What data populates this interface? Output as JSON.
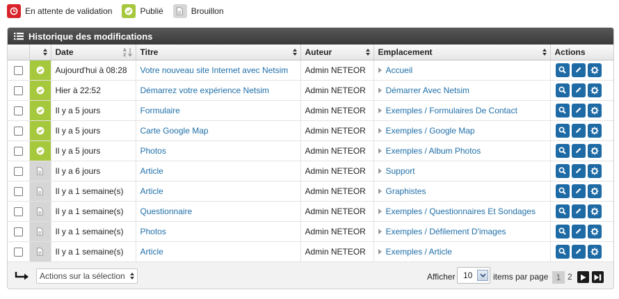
{
  "legend": [
    {
      "label": "En attente de validation",
      "icon": "pending-clock-icon",
      "color": "#d8232a"
    },
    {
      "label": "Publié",
      "icon": "published-check-icon",
      "color": "#a6c83c"
    },
    {
      "label": "Brouillon",
      "icon": "draft-document-icon",
      "color": "#d6d6d6"
    }
  ],
  "panel": {
    "title": "Historique des modifications"
  },
  "columns": {
    "date": "Date",
    "titre": "Titre",
    "auteur": "Auteur",
    "emplacement": "Emplacement",
    "actions": "Actions"
  },
  "rows": [
    {
      "status": "published",
      "date": "Aujourd'hui à 08:28",
      "titre": "Votre nouveau site Internet avec Netsim",
      "auteur": "Admin NETEOR",
      "emplacement": "Accueil"
    },
    {
      "status": "published",
      "date": "Hier à 22:52",
      "titre": "Démarrez votre expérience Netsim",
      "auteur": "Admin NETEOR",
      "emplacement": "Démarrer Avec Netsim"
    },
    {
      "status": "published",
      "date": "Il y a 5 jours",
      "titre": "Formulaire",
      "auteur": "Admin NETEOR",
      "emplacement": "Exemples / Formulaires De Contact"
    },
    {
      "status": "published",
      "date": "Il y a 5 jours",
      "titre": "Carte Google Map",
      "auteur": "Admin NETEOR",
      "emplacement": "Exemples / Google Map"
    },
    {
      "status": "published",
      "date": "Il y a 5 jours",
      "titre": "Photos",
      "auteur": "Admin NETEOR",
      "emplacement": "Exemples / Album Photos"
    },
    {
      "status": "draft",
      "date": "Il y a 6 jours",
      "titre": "Article",
      "auteur": "Admin NETEOR",
      "emplacement": "Support"
    },
    {
      "status": "draft",
      "date": "Il y a 1 semaine(s)",
      "titre": "Article",
      "auteur": "Admin NETEOR",
      "emplacement": "Graphistes"
    },
    {
      "status": "draft",
      "date": "Il y a 1 semaine(s)",
      "titre": "Questionnaire",
      "auteur": "Admin NETEOR",
      "emplacement": "Exemples / Questionnaires Et Sondages"
    },
    {
      "status": "draft",
      "date": "Il y a 1 semaine(s)",
      "titre": "Photos",
      "auteur": "Admin NETEOR",
      "emplacement": "Exemples / Défilement D'images"
    },
    {
      "status": "draft",
      "date": "Il y a 1 semaine(s)",
      "titre": "Article",
      "auteur": "Admin NETEOR",
      "emplacement": "Exemples / Article"
    }
  ],
  "footer": {
    "bulk_actions": "Actions sur la sélection",
    "afficher": "Afficher",
    "per_page_value": "10",
    "items_label": "items par page",
    "current_page": "1",
    "next_page": "2"
  },
  "colors": {
    "accent": "#1d6aa5",
    "link": "#1f6fa8",
    "published": "#a6c83c",
    "draft": "#d6d6d6",
    "pending": "#d8232a"
  }
}
